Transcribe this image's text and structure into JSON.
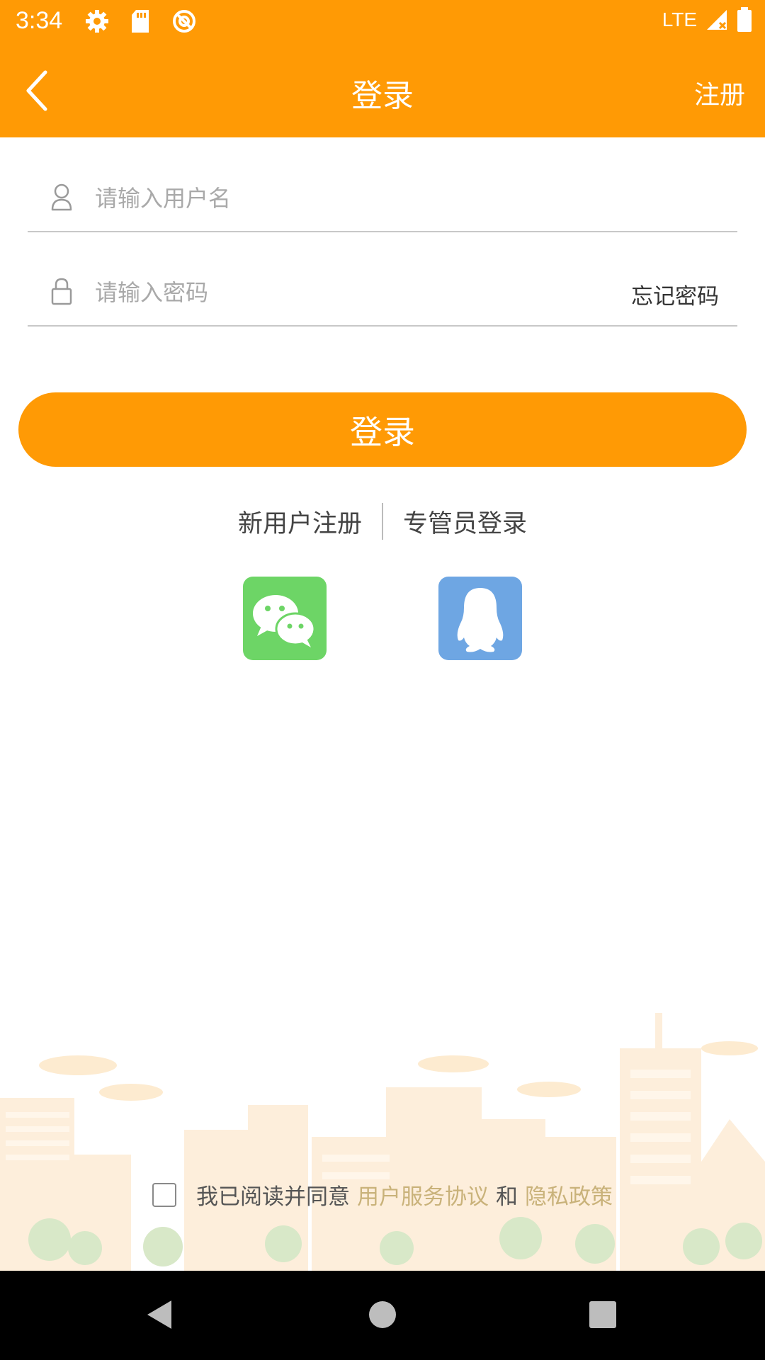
{
  "status_bar": {
    "time": "3:34",
    "network": "LTE",
    "icons_left": [
      "settings-icon",
      "sd-card-icon",
      "sync-icon"
    ],
    "icons_right": [
      "signal-icon",
      "battery-icon"
    ]
  },
  "app_bar": {
    "title": "登录",
    "right_action": "注册",
    "back_icon": "chevron-left-icon"
  },
  "form": {
    "username_placeholder": "请输入用户名",
    "password_placeholder": "请输入密码",
    "forgot_password": "忘记密码",
    "login_button": "登录"
  },
  "links": {
    "new_user": "新用户注册",
    "admin_login": "专管员登录"
  },
  "social": [
    "wechat-icon",
    "qq-icon"
  ],
  "agreement": {
    "prefix": "我已阅读并同意",
    "terms": "用户服务协议",
    "and": "和",
    "privacy": "隐私政策",
    "checked": false
  },
  "colors": {
    "primary": "#FF9A05",
    "wechat": "#6DD566",
    "qq": "#6EA6E3",
    "link": "#C9B27A"
  }
}
